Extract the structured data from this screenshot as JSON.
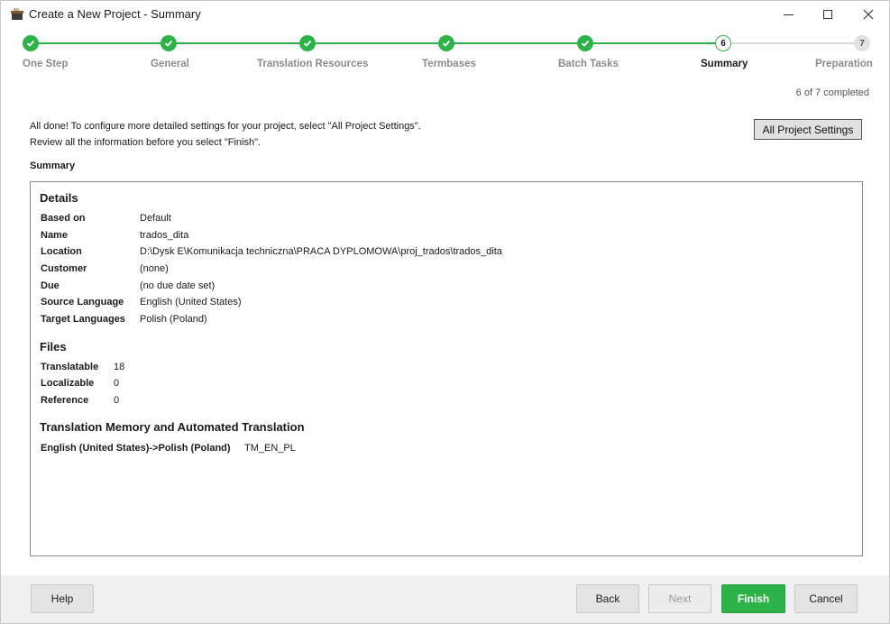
{
  "window": {
    "title": "Create a New Project - Summary"
  },
  "stepper": {
    "steps": [
      {
        "label": "One Step",
        "state": "done",
        "number": ""
      },
      {
        "label": "General",
        "state": "done",
        "number": ""
      },
      {
        "label": "Translation Resources",
        "state": "done",
        "number": ""
      },
      {
        "label": "Termbases",
        "state": "done",
        "number": ""
      },
      {
        "label": "Batch Tasks",
        "state": "done",
        "number": ""
      },
      {
        "label": "Summary",
        "state": "current",
        "number": "6"
      },
      {
        "label": "Preparation",
        "state": "future",
        "number": "7"
      }
    ],
    "progress_text": "6 of 7 completed",
    "colors": {
      "done": "#2db34a",
      "todo": "#d9d9d9"
    }
  },
  "intro": {
    "line1": "All done! To configure more detailed settings for your project, select \"All Project Settings\".",
    "line2": "Review all the information before you select \"Finish\"."
  },
  "all_project_settings_label": "All Project Settings",
  "summary": {
    "heading": "Summary",
    "details": {
      "title": "Details",
      "rows": [
        {
          "key": "Based on",
          "value": "Default"
        },
        {
          "key": "Name",
          "value": "trados_dita"
        },
        {
          "key": "Location",
          "value": "D:\\Dysk E\\Komunikacja techniczna\\PRACA DYPLOMOWA\\proj_trados\\trados_dita"
        },
        {
          "key": "Customer",
          "value": "(none)"
        },
        {
          "key": "Due",
          "value": "(no due date set)"
        },
        {
          "key": "Source Language",
          "value": "English (United States)"
        },
        {
          "key": "Target Languages",
          "value": "Polish (Poland)"
        }
      ]
    },
    "files": {
      "title": "Files",
      "rows": [
        {
          "key": "Translatable",
          "value": "18"
        },
        {
          "key": "Localizable",
          "value": "0"
        },
        {
          "key": "Reference",
          "value": "0"
        }
      ]
    },
    "tm": {
      "title": "Translation Memory and Automated Translation",
      "rows": [
        {
          "key": "English (United States)->Polish (Poland)",
          "value": "TM_EN_PL"
        }
      ]
    }
  },
  "footer": {
    "help": "Help",
    "back": "Back",
    "next": "Next",
    "finish": "Finish",
    "cancel": "Cancel"
  }
}
